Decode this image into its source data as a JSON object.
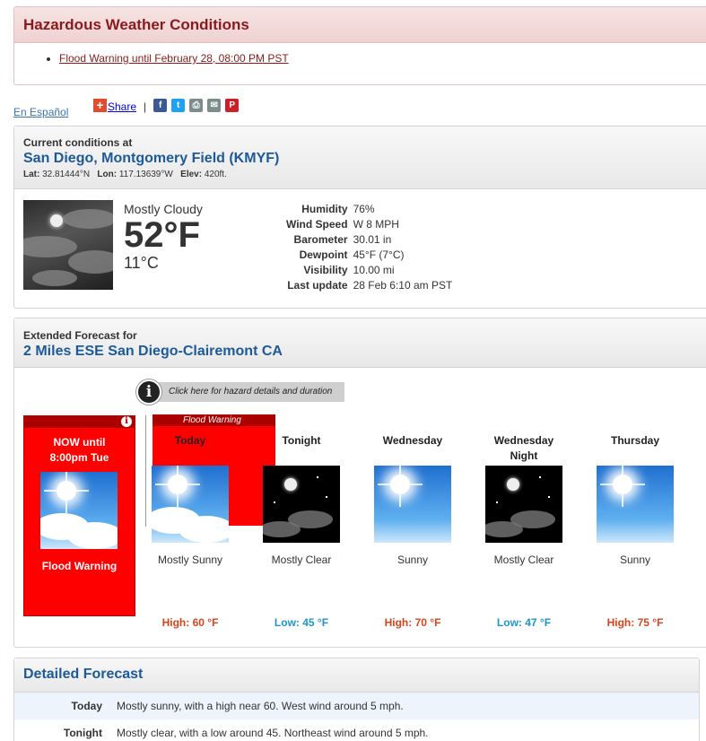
{
  "hazard": {
    "title": "Hazardous Weather Conditions",
    "items": [
      "Flood Warning until February 28, 08:00 PM PST"
    ]
  },
  "share_row": {
    "espanol": "En Español",
    "share": "Share",
    "separator": "|"
  },
  "current": {
    "header_label": "Current conditions at",
    "location": "San Diego, Montgomery Field (KMYF)",
    "lat_label": "Lat:",
    "lat": "32.81444°N",
    "lon_label": "Lon:",
    "lon": "117.13639°W",
    "elev_label": "Elev:",
    "elev": "420ft.",
    "condition": "Mostly Cloudy",
    "temp_f": "52°F",
    "temp_c": "11°C",
    "details": [
      {
        "k": "Humidity",
        "v": "76%"
      },
      {
        "k": "Wind Speed",
        "v": "W 8 MPH"
      },
      {
        "k": "Barometer",
        "v": "30.01 in"
      },
      {
        "k": "Dewpoint",
        "v": "45°F (7°C)"
      },
      {
        "k": "Visibility",
        "v": "10.00 mi"
      },
      {
        "k": "Last update",
        "v": "28 Feb 6:10 am PST"
      }
    ]
  },
  "extended": {
    "header_label": "Extended Forecast for",
    "location": "2 Miles ESE San Diego-Clairemont CA",
    "hazard_link": "Click here for hazard details and duration",
    "info_glyph": "i",
    "now": {
      "title_line1": "NOW until",
      "title_line2": "8:00pm Tue",
      "label": "Flood Warning"
    },
    "warning_banner": "Flood Warning",
    "periods": [
      {
        "name": "Today",
        "name2": "",
        "desc": "Mostly Sunny",
        "temp": "High: 60 °F",
        "kind": "hi",
        "icon": "sunny-cloud"
      },
      {
        "name": "Tonight",
        "name2": "",
        "desc": "Mostly Clear",
        "temp": "Low: 45 °F",
        "kind": "lo",
        "icon": "night-cloud"
      },
      {
        "name": "Wednesday",
        "name2": "",
        "desc": "Sunny",
        "temp": "High: 70 °F",
        "kind": "hi",
        "icon": "sunny"
      },
      {
        "name": "Wednesday",
        "name2": "Night",
        "desc": "Mostly Clear",
        "temp": "Low: 47 °F",
        "kind": "lo",
        "icon": "night-cloud"
      },
      {
        "name": "Thursday",
        "name2": "",
        "desc": "Sunny",
        "temp": "High: 75 °F",
        "kind": "hi",
        "icon": "sunny"
      }
    ]
  },
  "detailed": {
    "title": "Detailed Forecast",
    "rows": [
      {
        "name": "Today",
        "text": "Mostly sunny, with a high near 60. West wind around 5 mph."
      },
      {
        "name": "Tonight",
        "text": "Mostly clear, with a low around 45. Northeast wind around 5 mph."
      }
    ]
  },
  "colors": {
    "hazard_title": "#8a1a1a",
    "link_blue": "#3b73b9",
    "location_blue": "#1d5a9a",
    "warning_red": "#ff0000",
    "high_temp": "#d9441d",
    "low_temp": "#1e95c9"
  }
}
